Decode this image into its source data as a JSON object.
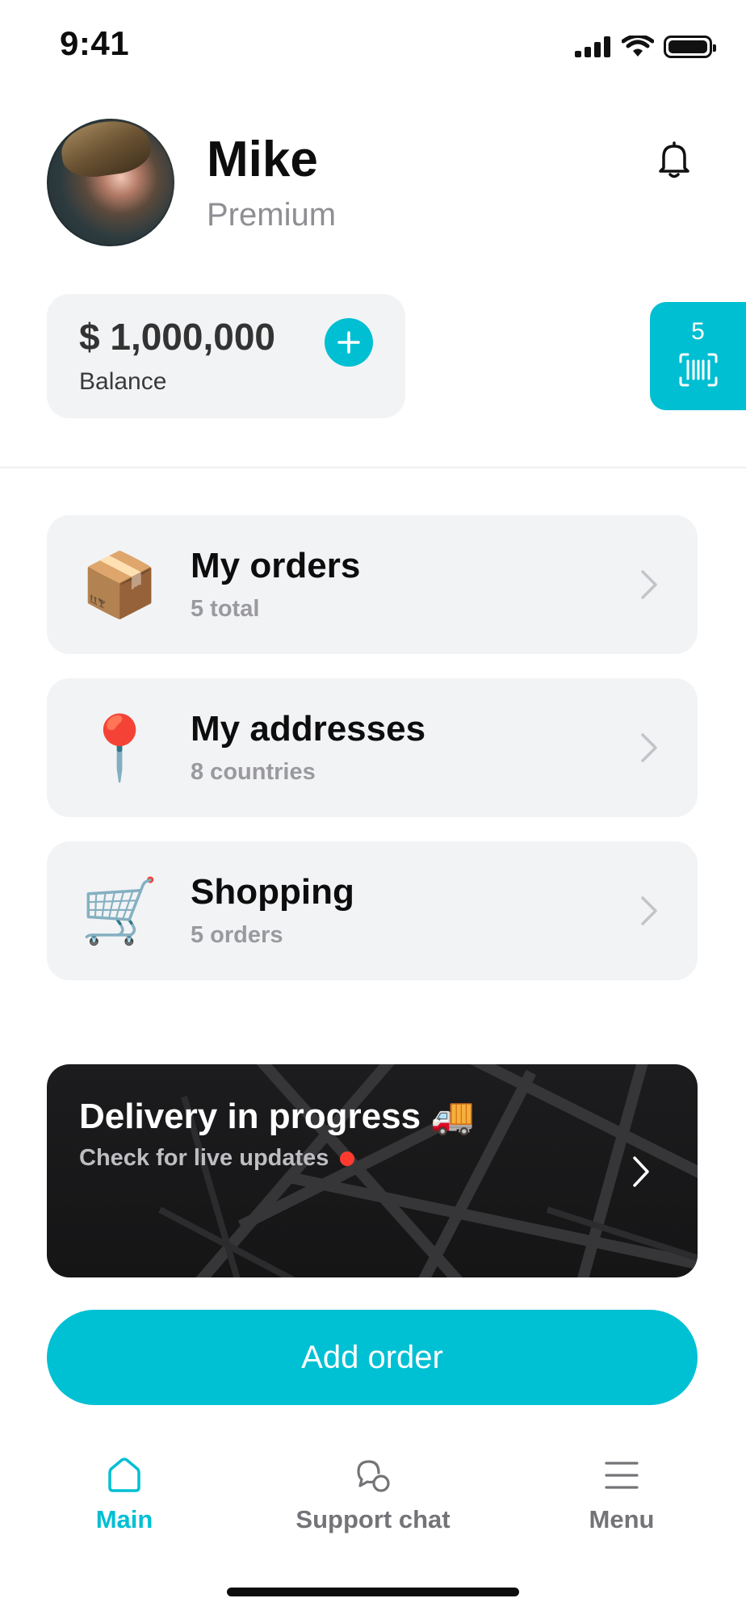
{
  "status_bar": {
    "time": "9:41",
    "icons": [
      "signal-icon",
      "wifi-icon",
      "battery-icon"
    ]
  },
  "profile": {
    "name": "Mike",
    "tier": "Premium",
    "notification_icon": "bell-icon"
  },
  "balance": {
    "amount": "$ 1,000,000",
    "label": "Balance",
    "add_icon": "plus-icon"
  },
  "coupons": {
    "count": "5",
    "icon": "barcode-icon"
  },
  "menu": {
    "items": [
      {
        "title": "My orders",
        "subtitle": "5 total",
        "emoji": "📦",
        "icon": "package-icon"
      },
      {
        "title": "My addresses",
        "subtitle": "8 countries",
        "emoji": "📍",
        "icon": "pin-icon"
      },
      {
        "title": "Shopping",
        "subtitle": "5 orders",
        "emoji": "🛒",
        "icon": "cart-icon"
      }
    ]
  },
  "delivery": {
    "title": "Delivery in progress 🚚",
    "subtitle": "Check for live updates",
    "live_color": "#ff3b30"
  },
  "cta": {
    "label": "Add order"
  },
  "bottom_nav": {
    "items": [
      {
        "label": "Main",
        "icon": "home-icon",
        "active": true
      },
      {
        "label": "Support chat",
        "icon": "chat-icon",
        "active": false
      },
      {
        "label": "Menu",
        "icon": "menu-icon",
        "active": false
      }
    ]
  },
  "colors": {
    "accent": "#00bfd3",
    "card_bg": "#f2f3f5",
    "muted_text": "#9a9a9e",
    "dark_banner": "#1c1c1e"
  }
}
